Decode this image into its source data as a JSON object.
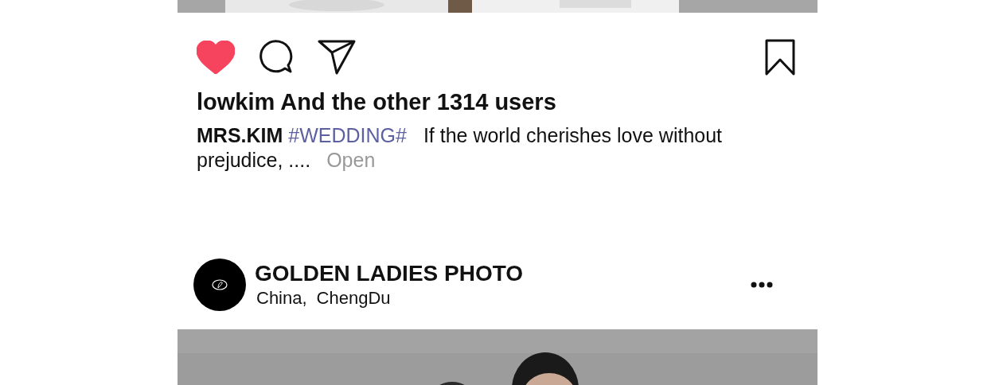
{
  "posts": [
    {
      "kind": "footer",
      "liked": true,
      "saved": false,
      "likes": "lowkim And the other 1314 users",
      "caption": {
        "author": "MRS.KIM",
        "hashtag": "#WEDDING#",
        "text": "If the world cherishes love without prejudice, ....",
        "more": "Open"
      }
    },
    {
      "kind": "header",
      "account": "GOLDEN LADIES PHOTO",
      "location_parts": [
        "China,",
        "ChengDu"
      ]
    }
  ]
}
